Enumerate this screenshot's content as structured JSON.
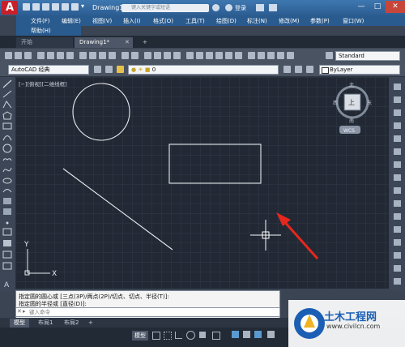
{
  "app": {
    "logo_letter": "A",
    "doc_title": "Drawing1.dwg",
    "search_placeholder": "键入关键字或短语",
    "login": "登录",
    "window_controls": [
      "—",
      "□",
      "✕"
    ]
  },
  "menu": [
    "文件(F)",
    "编辑(E)",
    "视图(V)",
    "插入(I)",
    "格式(O)",
    "工具(T)",
    "绘图(D)",
    "标注(N)",
    "修改(M)",
    "参数(P)",
    "窗口(W)"
  ],
  "menu_second_row": "帮助(H)",
  "tabs": [
    {
      "label": "开始",
      "active": false
    },
    {
      "label": "Drawing1*",
      "active": true
    },
    {
      "label": "+",
      "active": false
    }
  ],
  "toolbar": {
    "workspace": "AutoCAD 经典",
    "layer": "0",
    "text_style": "Standard",
    "color": "ByLayer"
  },
  "canvas": {
    "viewport_label": "[−][俯视][二维线框]",
    "viewcube_top": "上",
    "compass": {
      "n": "北",
      "s": "南",
      "e": "东",
      "w": "西"
    },
    "ucs_label": "WCS",
    "axis_y": "Y",
    "axis_x": "X",
    "colors": {
      "background": "#222934",
      "geometry": "#e8eaee",
      "arrow": "#e5271d"
    }
  },
  "command": {
    "line1": "指定圆的圆心或 [三点(3P)/两点(2P)/切点、切点、半径(T)]:",
    "line2": "指定圆的半径或 [直径(D)]:",
    "input_placeholder": "键入命令"
  },
  "layout_tabs": [
    "模型",
    "布局1",
    "布局2",
    "+"
  ],
  "status": {
    "model_label": "模型"
  },
  "watermark": {
    "title": "土木工程网",
    "url": "www.civilcn.com"
  }
}
